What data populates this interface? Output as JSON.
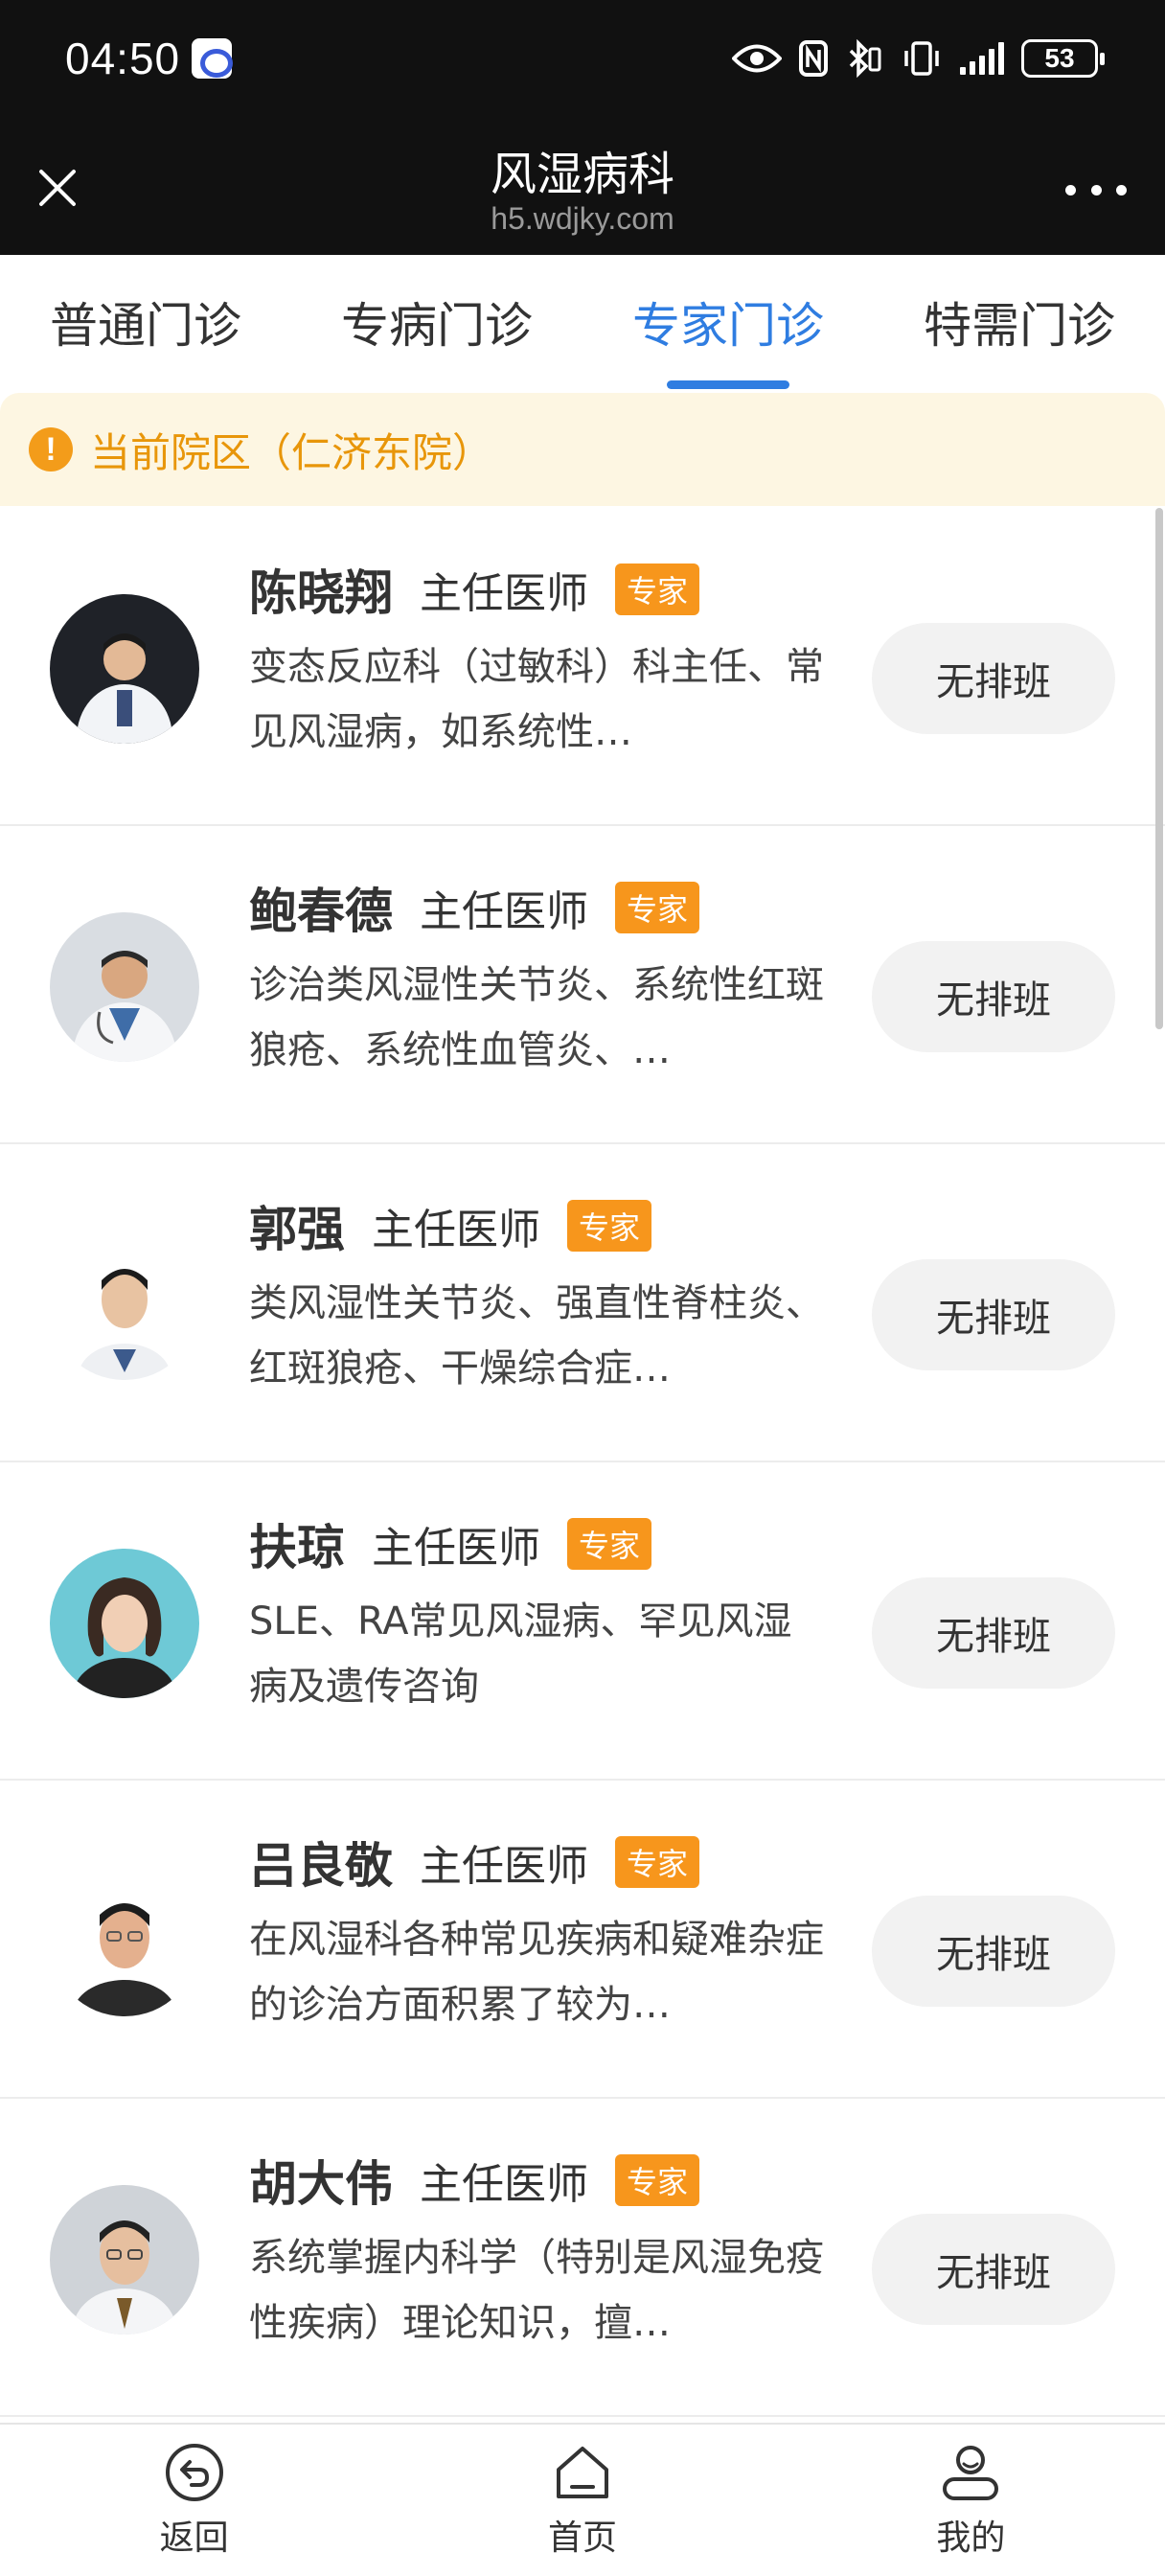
{
  "status_bar": {
    "time": "04:50",
    "battery": "53"
  },
  "header": {
    "title": "风湿病科",
    "domain": "h5.wdjky.com"
  },
  "tabs": [
    {
      "label": "普通门诊",
      "active": false
    },
    {
      "label": "专病门诊",
      "active": false
    },
    {
      "label": "专家门诊",
      "active": true
    },
    {
      "label": "特需门诊",
      "active": false
    }
  ],
  "notice": {
    "icon": "!",
    "text": "当前院区（仁济东院）"
  },
  "doctors": [
    {
      "name": "陈晓翔",
      "title": "主任医师",
      "badge": "专家",
      "desc": "变态反应科（过敏科）科主任、常见风湿病，如系统性…",
      "schedule": "无排班"
    },
    {
      "name": "鲍春德",
      "title": "主任医师",
      "badge": "专家",
      "desc": "诊治类风湿性关节炎、系统性红斑狼疮、系统性血管炎、…",
      "schedule": "无排班"
    },
    {
      "name": "郭强",
      "title": "主任医师",
      "badge": "专家",
      "desc": "类风湿性关节炎、强直性脊柱炎、红斑狼疮、干燥综合症…",
      "schedule": "无排班"
    },
    {
      "name": "扶琼",
      "title": "主任医师",
      "badge": "专家",
      "desc": "SLE、RA常见风湿病、罕见风湿病及遗传咨询",
      "schedule": "无排班"
    },
    {
      "name": "吕良敬",
      "title": "主任医师",
      "badge": "专家",
      "desc": "在风湿科各种常见疾病和疑难杂症的诊治方面积累了较为…",
      "schedule": "无排班"
    },
    {
      "name": "胡大伟",
      "title": "主任医师",
      "badge": "专家",
      "desc": "系统掌握内科学（特别是风湿免疫性疾病）理论知识，擅…",
      "schedule": "无排班"
    }
  ],
  "bottom_nav": [
    {
      "label": "返回",
      "icon": "back-icon"
    },
    {
      "label": "首页",
      "icon": "home-icon"
    },
    {
      "label": "我的",
      "icon": "profile-icon"
    }
  ],
  "colors": {
    "accent": "#2f7de1",
    "badge": "#f7961c",
    "notice_bg": "#fdf6e2",
    "notice_text": "#e8960a"
  }
}
